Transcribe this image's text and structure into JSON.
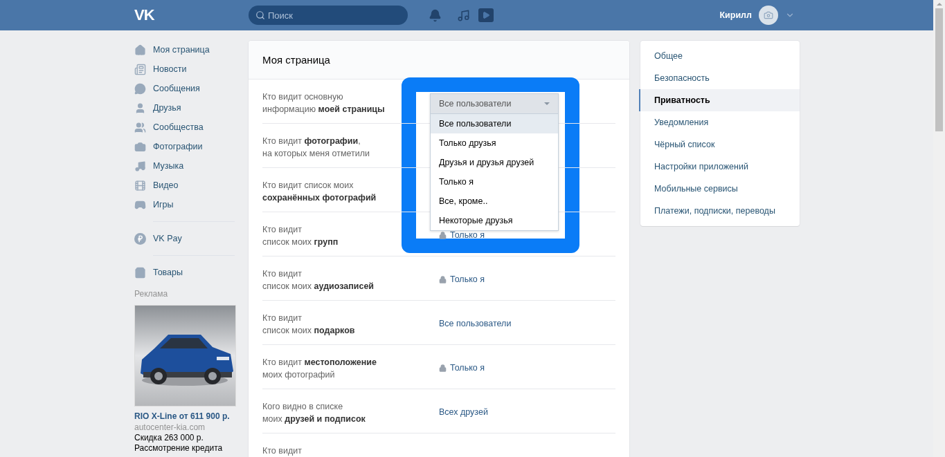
{
  "header": {
    "logo": "VK",
    "search": {
      "placeholder": "Поиск"
    },
    "user": {
      "name": "Кирилл"
    }
  },
  "sidebar": {
    "groups": [
      [
        {
          "label": "Моя страница"
        },
        {
          "label": "Новости"
        },
        {
          "label": "Сообщения"
        },
        {
          "label": "Друзья"
        },
        {
          "label": "Сообщества"
        },
        {
          "label": "Фотографии"
        },
        {
          "label": "Музыка"
        },
        {
          "label": "Видео"
        },
        {
          "label": "Игры"
        }
      ],
      [
        {
          "label": "VK Pay"
        }
      ],
      [
        {
          "label": "Товары"
        }
      ]
    ],
    "ad": {
      "heading": "Реклама",
      "title": "RIO X-Line от 611 900 р.",
      "domain": "autocenter-kia.com",
      "lines": [
        "Скидка 263 000 р.",
        "Рассмотрение кредита"
      ]
    }
  },
  "main": {
    "title": "Моя страница",
    "rows": [
      {
        "label": "Кто видит основную\nинформацию **моей страницы**",
        "select": {
          "value": "Все пользователи",
          "open": true,
          "options": [
            {
              "label": "Все пользователи",
              "selected": true
            },
            {
              "label": "Только друзья",
              "selected": false
            },
            {
              "label": "Друзья и друзья друзей",
              "selected": false
            },
            {
              "label": "Только я",
              "selected": false
            },
            {
              "label": "Все, кроме..",
              "selected": false
            },
            {
              "label": "Некоторые друзья",
              "selected": false
            }
          ]
        }
      },
      {
        "label": "Кто видит **фотографии**,\nна которых меня отметили"
      },
      {
        "label": "Кто видит список моих\n**сохранённых фотографий**"
      },
      {
        "label": "Кто видит\nсписок моих **групп**",
        "value": "Только я",
        "locked": true
      },
      {
        "label": "Кто видит\nсписок моих **аудиозаписей**",
        "value": "Только я",
        "locked": true
      },
      {
        "label": "Кто видит\nсписок моих **подарков**",
        "value": "Все пользователи",
        "locked": false
      },
      {
        "label": "Кто видит **местоположение**\nмоих фотографий",
        "value": "Только я",
        "locked": true
      },
      {
        "label": "Кого видно в списке\nмоих **друзей и подписок**",
        "value": "Всех друзей",
        "locked": false
      },
      {
        "label": "Кто видит"
      }
    ]
  },
  "settings_menu": {
    "items": [
      {
        "label": "Общее",
        "selected": false
      },
      {
        "label": "Безопасность",
        "selected": false
      },
      {
        "label": "Приватность",
        "selected": true
      },
      {
        "label": "Уведомления",
        "selected": false
      },
      {
        "label": "Чёрный список",
        "selected": false
      },
      {
        "label": "Настройки приложений",
        "selected": false
      },
      {
        "label": "Мобильные сервисы",
        "selected": false
      },
      {
        "label": "Платежи, подписки, переводы",
        "selected": false
      }
    ]
  }
}
